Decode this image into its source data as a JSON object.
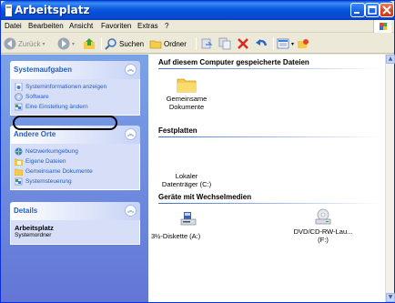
{
  "window": {
    "title": "Arbeitsplatz",
    "accent": "#0a5fd8"
  },
  "menu": {
    "items": [
      "Datei",
      "Bearbeiten",
      "Ansicht",
      "Favoriten",
      "Extras",
      "?"
    ]
  },
  "toolbar": {
    "back_label": "Zurück",
    "search_label": "Suchen",
    "folders_label": "Ordner"
  },
  "left": {
    "system_tasks": {
      "title": "Systemaufgaben",
      "items": [
        "Systeminformationen anzeigen",
        "Software",
        "Eine Einstellung ändern"
      ]
    },
    "other_places": {
      "title": "Andere Orte",
      "items": [
        "Netzwerkumgebung",
        "Eigene Dateien",
        "Gemeinsame Dokumente",
        "Systemsteuerung"
      ]
    },
    "details": {
      "title": "Details",
      "name": "Arbeitsplatz",
      "sub": "Systemordner"
    }
  },
  "right": {
    "group_files": "Auf diesem Computer gespeicherte Dateien",
    "shared_docs_line1": "Gemeinsame",
    "shared_docs_line2": "Dokumente",
    "group_disks": "Festplatten",
    "local_disk_line1": "Lokaler",
    "local_disk_line2": "Datenträger (C:)",
    "group_removable": "Geräte mit Wechselmedien",
    "floppy": "3½-Diskette (A:)",
    "dvd_line1": "DVD/CD-RW-Lau...",
    "dvd_line2": "(F:)"
  }
}
